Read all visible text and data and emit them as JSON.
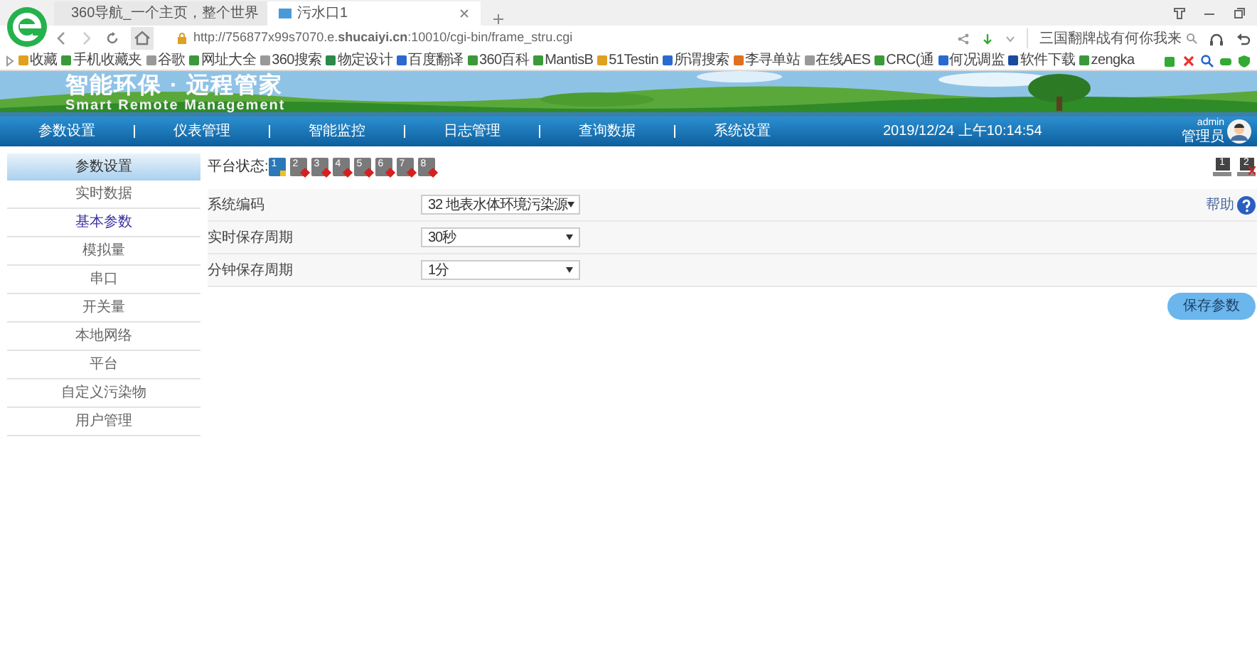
{
  "browser": {
    "tabs": [
      {
        "title": "360导航_一个主页，整个世界",
        "selected": false
      },
      {
        "title": "污水口1",
        "selected": true
      }
    ],
    "url": "http://756877x99s7070.e.**shucaiyi.cn**:10010/cgi-bin/frame_stru.cgi",
    "search_text": "三国翻牌战有何你我来",
    "bookmarks": [
      {
        "label": "收藏",
        "color": "#e0a020"
      },
      {
        "label": "手机收藏夹",
        "color": "#3a9a3a"
      },
      {
        "label": "谷歌",
        "color": "#999999"
      },
      {
        "label": "网址大全",
        "color": "#3a9a3a"
      },
      {
        "label": "360搜索",
        "color": "#999999"
      },
      {
        "label": "物定设计",
        "color": "#2a8a4a"
      },
      {
        "label": "百度翻译",
        "color": "#2a6ad0"
      },
      {
        "label": "360百科",
        "color": "#3a9a3a"
      },
      {
        "label": "MantisB",
        "color": "#3a9a3a"
      },
      {
        "label": "51Testin",
        "color": "#e0a020"
      },
      {
        "label": "所谓搜索",
        "color": "#2a6ad0"
      },
      {
        "label": "李寻单站",
        "color": "#e07020"
      },
      {
        "label": "在线AES",
        "color": "#999999"
      },
      {
        "label": "CRC(通",
        "color": "#3a9a3a"
      },
      {
        "label": "何况调监",
        "color": "#2a6ad0"
      },
      {
        "label": "软件下载",
        "color": "#1a4aa0"
      },
      {
        "label": "zengka",
        "color": "#3a9a3a"
      }
    ]
  },
  "banner": {
    "title": "智能环保 · 远程管家",
    "subtitle": "Smart Remote Management"
  },
  "nav": {
    "items": [
      {
        "label": "参数设置"
      },
      {
        "label": "仪表管理"
      },
      {
        "label": "智能监控"
      },
      {
        "label": "日志管理"
      },
      {
        "label": "查询数据"
      },
      {
        "label": "系统设置"
      }
    ],
    "datetime": "2019/12/24 上午10:14:54",
    "user": "admin",
    "role": "管理员"
  },
  "sidebar": {
    "header": "参数设置",
    "items": [
      {
        "label": "实时数据",
        "selected": false
      },
      {
        "label": "基本参数",
        "selected": true
      },
      {
        "label": "模拟量",
        "selected": false
      },
      {
        "label": "串口",
        "selected": false
      },
      {
        "label": "开关量",
        "selected": false
      },
      {
        "label": "本地网络",
        "selected": false
      },
      {
        "label": "平台",
        "selected": false
      },
      {
        "label": "自定义污染物",
        "selected": false
      },
      {
        "label": "用户管理",
        "selected": false
      }
    ]
  },
  "platform_status": {
    "label": "平台状态:",
    "channels": [
      {
        "number": "1",
        "online": true
      },
      {
        "number": "2",
        "online": false
      },
      {
        "number": "3",
        "online": false
      },
      {
        "number": "4",
        "online": false
      },
      {
        "number": "5",
        "online": false
      },
      {
        "number": "6",
        "online": false
      },
      {
        "number": "7",
        "online": false
      },
      {
        "number": "8",
        "online": false
      }
    ]
  },
  "servers": [
    {
      "number": "1",
      "online": true
    },
    {
      "number": "2",
      "online": false
    }
  ],
  "help": "帮助",
  "form_rows": [
    {
      "label": "系统编码",
      "value": "32 地表水体环境污染源"
    },
    {
      "label": "实时保存周期",
      "value": "30秒"
    },
    {
      "label": "分钟保存周期",
      "value": "1分"
    }
  ],
  "save_button": "保存参数"
}
